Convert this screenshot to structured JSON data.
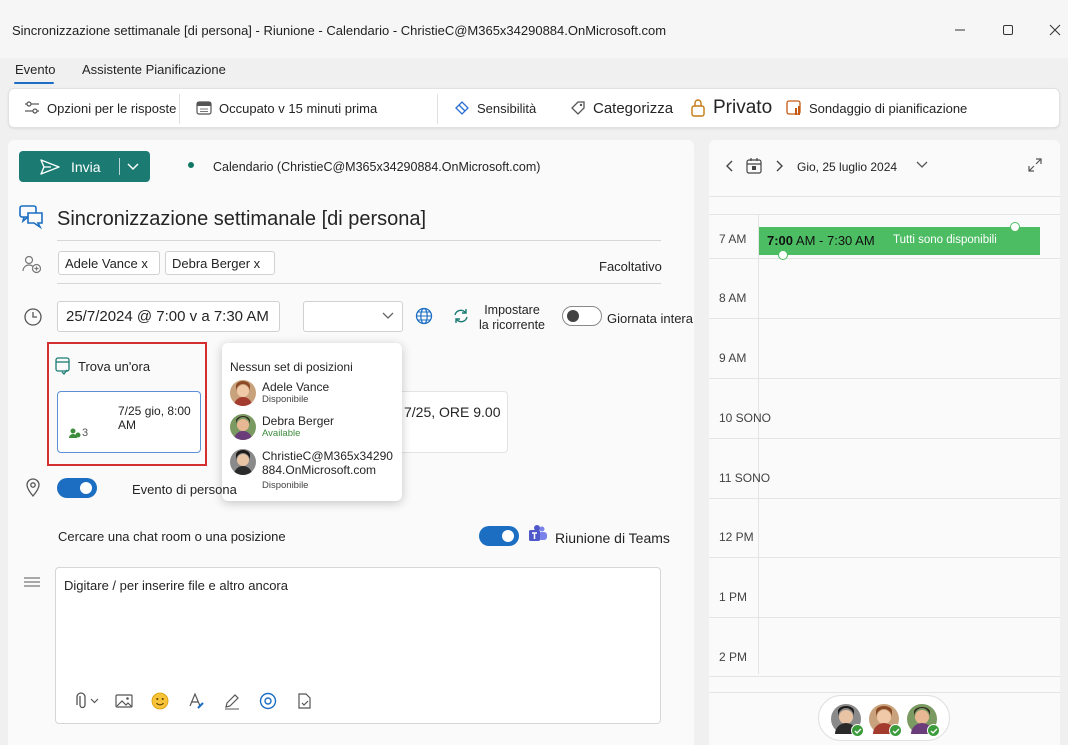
{
  "window": {
    "title": "Sincronizzazione settimanale [di persona] - Riunione - Calendario - ChristieC@M365x34290884.OnMicrosoft.com"
  },
  "tabs": [
    {
      "label": "Evento",
      "active": true
    },
    {
      "label": "Assistente Pianificazione",
      "active": false
    }
  ],
  "ribbon": {
    "response_options": "Opzioni per le risposte",
    "busy_reminder": "Occupato v 15 minuti prima",
    "sensitivity": "Sensibilità",
    "categorize": "Categorizza",
    "private": "Privato",
    "scheduling_poll": "Sondaggio di pianificazione"
  },
  "compose": {
    "send_label": "Invia",
    "calendar_label": "Calendario (ChristieC@M365x34290884.OnMicrosoft.com)",
    "subject": "Sincronizzazione settimanale [di persona]",
    "attendees": [
      "Adele Vance x",
      "Debra Berger x"
    ],
    "optional_label": "Facoltativo",
    "datetime": "25/7/2024 @ 7:00 v a 7:30 AM",
    "recurrence_line1": "Impostare",
    "recurrence_line2": "la ricorrente",
    "all_day_label": "Giornata intera",
    "find_time_label": "Trova un'ora",
    "slot1_time": "7/25 gio, 8:00 AM",
    "slot1_count": "3",
    "slot2_time": "7/25, ORE 9.00",
    "in_person_label": "Evento di persona",
    "location_placeholder": "Cercare una chat room o una posizione",
    "teams_label": "Riunione di Teams",
    "body_placeholder": "Digitare / per inserire file e altro ancora"
  },
  "popup": {
    "title": "Nessun set di posizioni",
    "people": [
      {
        "name": "Adele Vance",
        "status": "Disponibile",
        "status_color": "#444444"
      },
      {
        "name": "Debra Berger",
        "status": "Available",
        "status_color": "#3c8c3c"
      },
      {
        "name_line1": "ChristieC@M365x34290",
        "name_line2": "884.OnMicrosoft.com",
        "status": "Disponibile",
        "status_color": "#444444"
      }
    ]
  },
  "calendar": {
    "date_label": "Gio, 25 luglio 2024",
    "hours": [
      "7 AM",
      "8 AM",
      "9 AM",
      "10 SONO",
      "11 SONO",
      "12 PM",
      "1 PM",
      "2 PM"
    ],
    "event_time_bold": "7:00",
    "event_time_rest": " AM - 7:30 AM",
    "event_status": "Tutti sono disponibili",
    "event_color": "#4cbd63"
  },
  "colors": {
    "accent": "#1b7b73",
    "toggle_on": "#1b6ec2",
    "highlight_border": "#d32f2f"
  }
}
